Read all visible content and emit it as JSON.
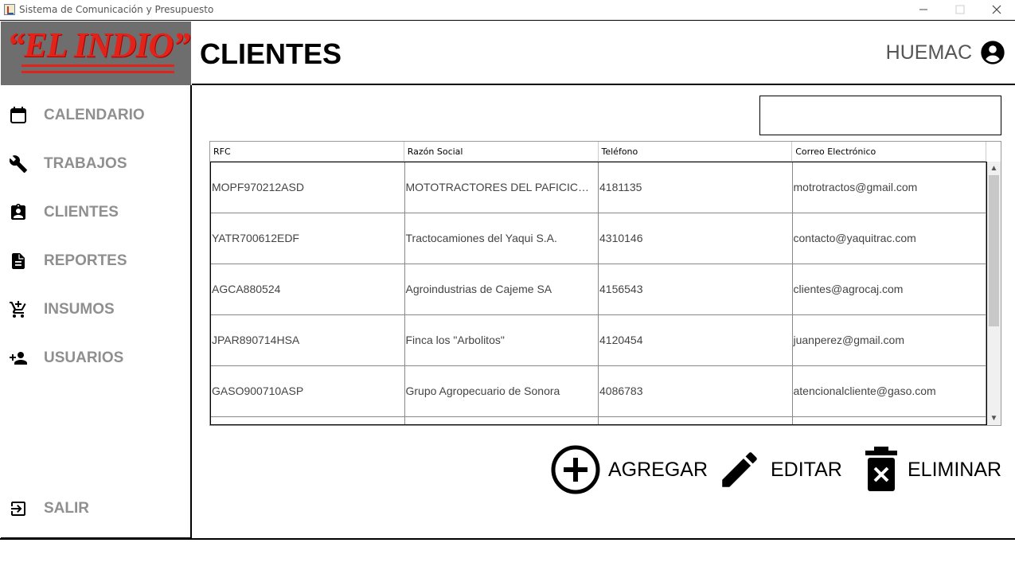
{
  "window": {
    "title": "Sistema de Comunicación y Presupuesto"
  },
  "logo": {
    "text": "“EL INDIO”"
  },
  "header": {
    "title": "CLIENTES",
    "user": "HUEMAC"
  },
  "sidebar": {
    "items": [
      {
        "label": "CALENDARIO",
        "icon": "calendar-icon"
      },
      {
        "label": "TRABAJOS",
        "icon": "wrench-icon"
      },
      {
        "label": "CLIENTES",
        "icon": "clipboard-user-icon"
      },
      {
        "label": "REPORTES",
        "icon": "document-icon"
      },
      {
        "label": "INSUMOS",
        "icon": "cart-add-icon"
      },
      {
        "label": "USUARIOS",
        "icon": "add-user-icon"
      }
    ],
    "logout": {
      "label": "SALIR",
      "icon": "exit-icon"
    }
  },
  "search": {
    "value": ""
  },
  "table": {
    "columns": [
      "RFC",
      "Razón Social",
      "Teléfono",
      "Correo Electrónico"
    ],
    "rows": [
      [
        "MOPF970212ASD",
        "MOTOTRACTORES DEL PAFICICO S.A.",
        "4181135",
        "motrotractos@gmail.com"
      ],
      [
        "YATR700612EDF",
        "Tractocamiones del Yaqui S.A.",
        "4310146",
        "contacto@yaquitrac.com"
      ],
      [
        "AGCA880524",
        "Agroindustrias de Cajeme SA",
        "4156543",
        "clientes@agrocaj.com"
      ],
      [
        "JPAR890714HSA",
        "Finca los \"Arbolitos\"",
        "4120454",
        "juanperez@gmail.com"
      ],
      [
        "GASO900710ASP",
        "Grupo Agropecuario de Sonora",
        "4086783",
        "atencionalcliente@gaso.com"
      ]
    ]
  },
  "actions": {
    "add": "AGREGAR",
    "edit": "EDITAR",
    "delete": "ELIMINAR"
  },
  "colors": {
    "logo_bg": "#6e6e6e",
    "logo_red": "#e2231a",
    "nav_text": "#8f8f8f"
  }
}
